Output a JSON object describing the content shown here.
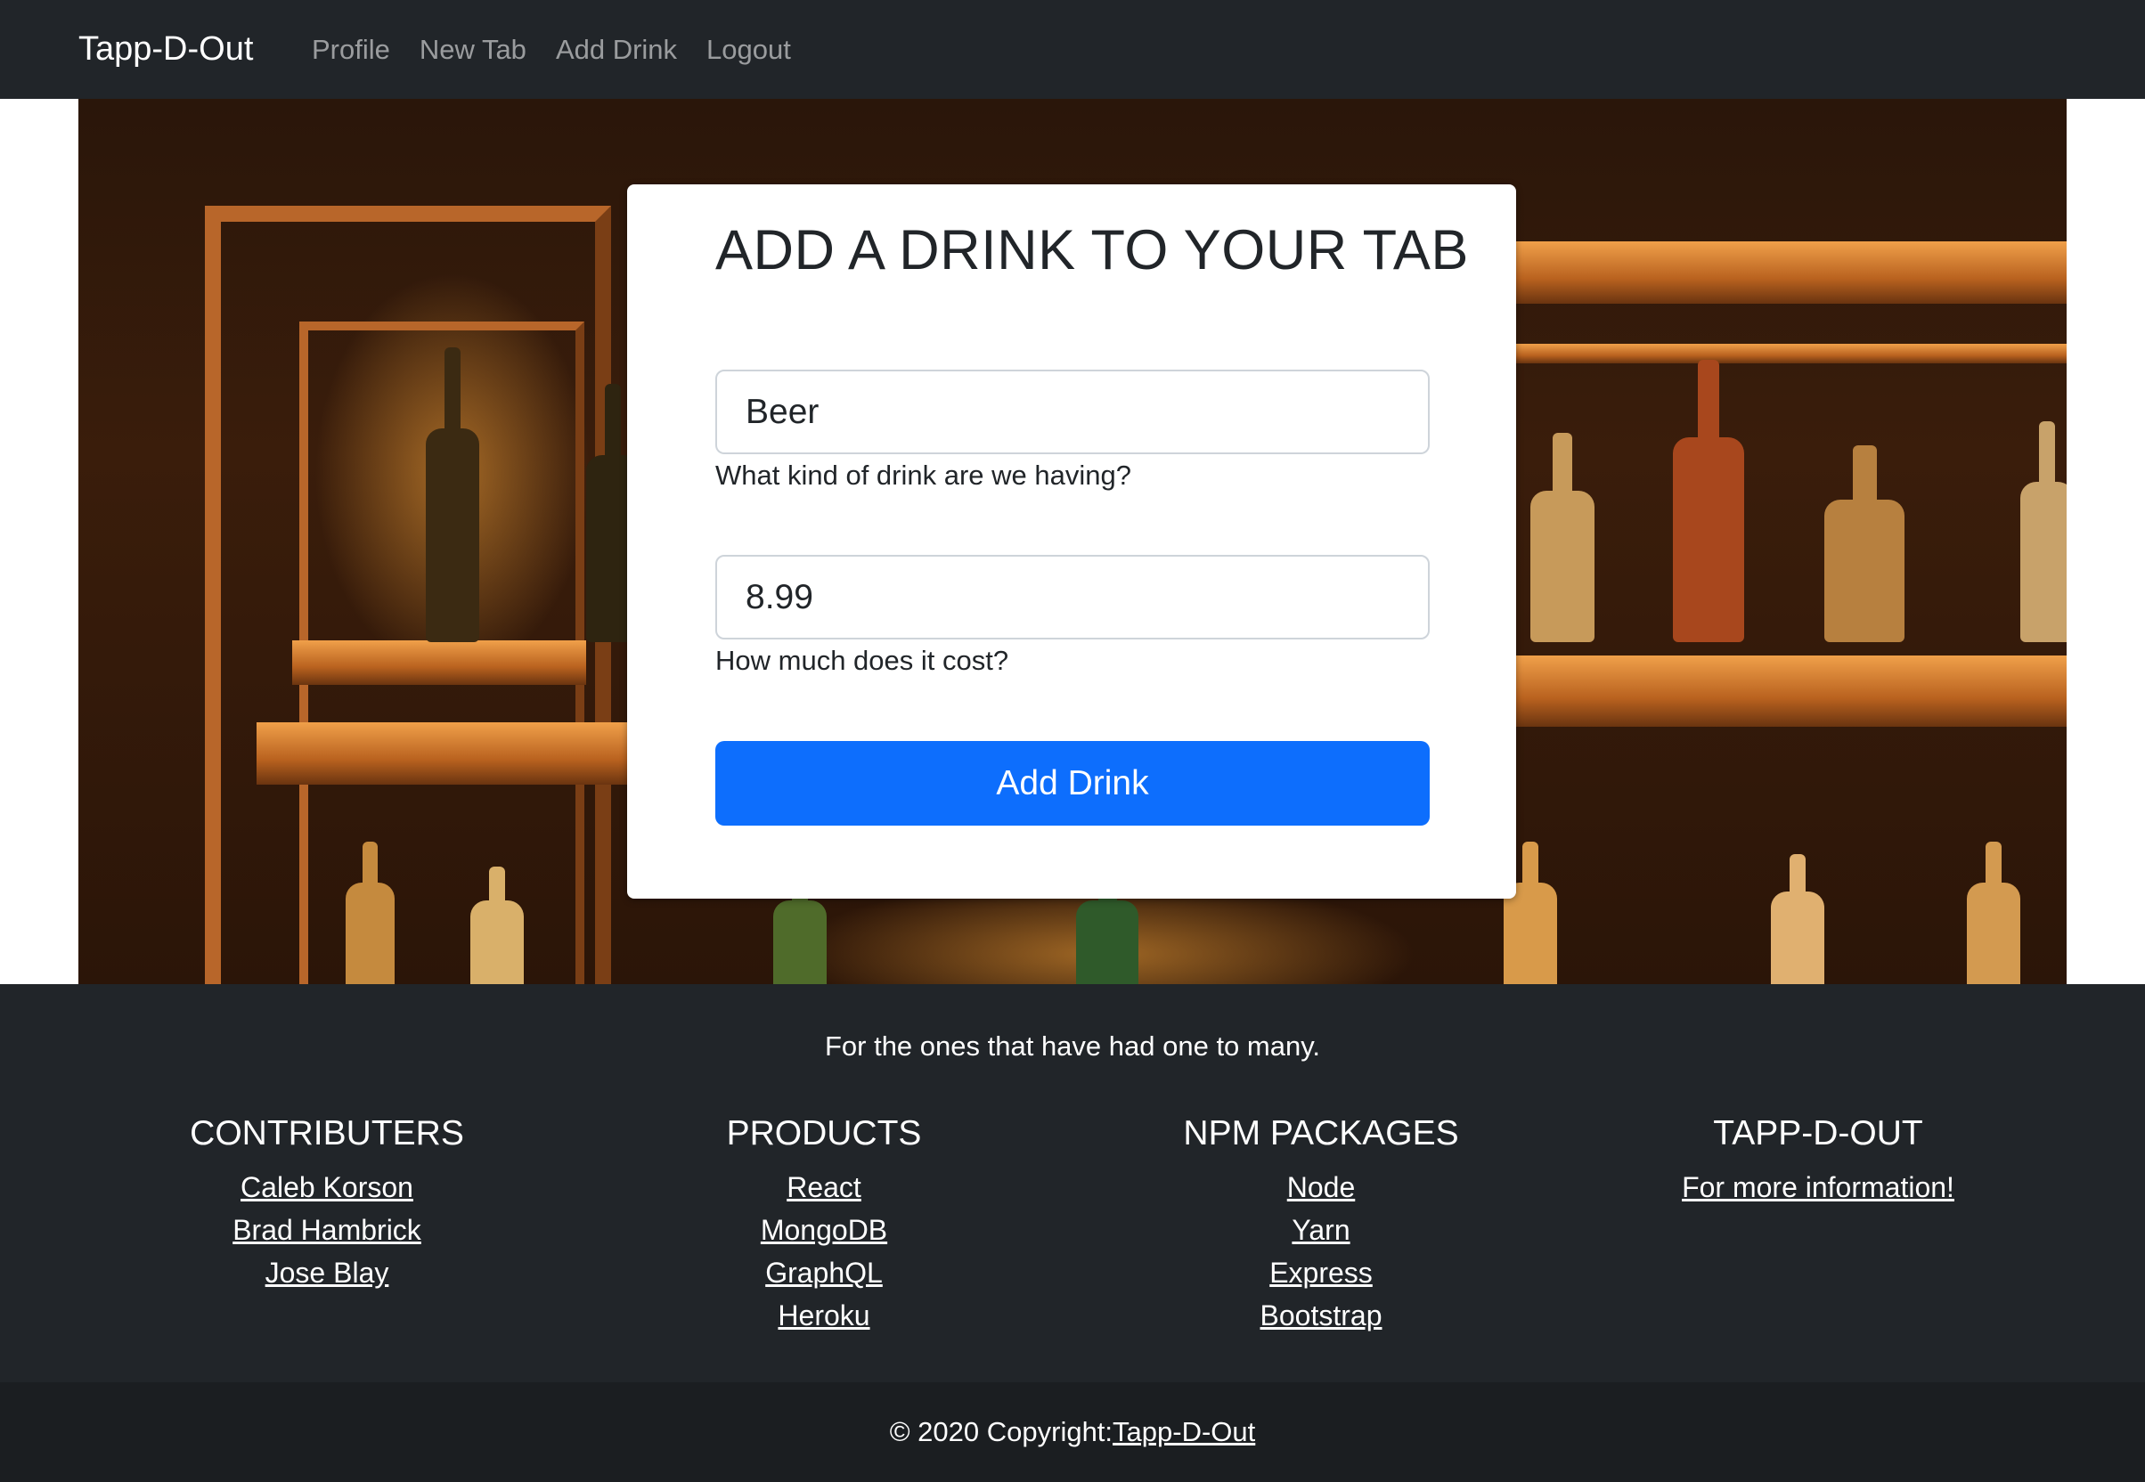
{
  "navbar": {
    "brand": "Tapp-D-Out",
    "links": [
      "Profile",
      "New Tab",
      "Add Drink",
      "Logout"
    ]
  },
  "form": {
    "title": "ADD A DRINK TO YOUR TAB",
    "drink_value": "Beer",
    "drink_help": "What kind of drink are we having?",
    "cost_value": "8.99",
    "cost_help": "How much does it cost?",
    "submit_label": "Add Drink"
  },
  "footer": {
    "tagline": "For the ones that have had one to many.",
    "columns": [
      {
        "heading": "CONTRIBUTERS",
        "links": [
          "Caleb Korson",
          "Brad Hambrick",
          "Jose Blay"
        ]
      },
      {
        "heading": "PRODUCTS",
        "links": [
          "React",
          "MongoDB",
          "GraphQL",
          "Heroku"
        ]
      },
      {
        "heading": "NPM PACKAGES",
        "links": [
          "Node",
          "Yarn",
          "Express",
          "Bootstrap"
        ]
      },
      {
        "heading": "TAPP-D-OUT",
        "links": [
          "For more information!"
        ]
      }
    ],
    "copyright_prefix": "© 2020 Copyright:",
    "copyright_link": "Tapp-D-Out"
  },
  "colors": {
    "navbar_bg": "#212529",
    "primary": "#0d6efd",
    "copyright_bg": "#1b1e21"
  }
}
